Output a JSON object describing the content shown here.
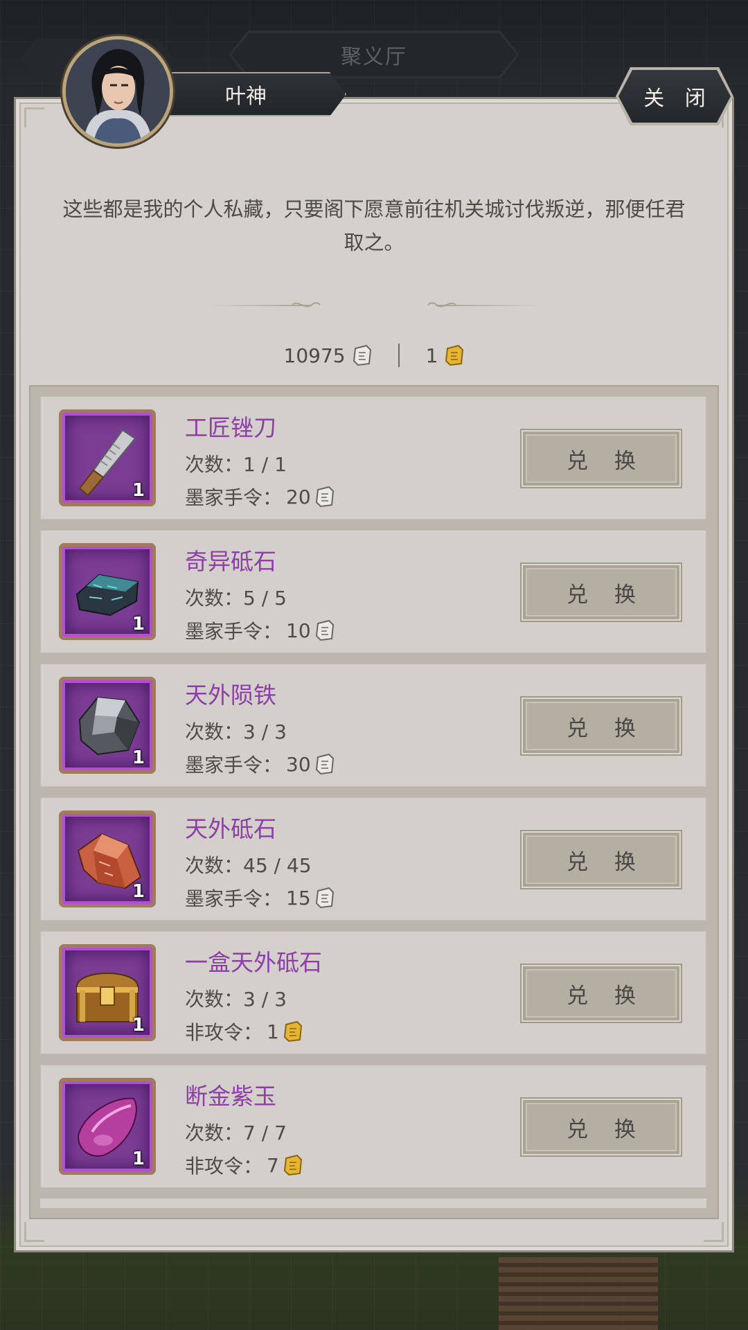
{
  "window": {
    "title": "聚义厅"
  },
  "npc": {
    "name": "叶神"
  },
  "close_label": "关 闭",
  "intro": "这些都是我的个人私藏，只要阁下愿意前往机关城讨伐叛逆，那便任君取之。",
  "currencies": [
    {
      "value": "10975",
      "icon": "mojia-token-icon",
      "color": "#e9e6df"
    },
    {
      "value": "1",
      "icon": "feigong-token-icon",
      "color": "#e2b23a"
    }
  ],
  "items": [
    {
      "name": "工匠锉刀",
      "count": "1",
      "times_label": "次数：",
      "times": "1 / 1",
      "cost_label": "墨家手令：",
      "cost": "20",
      "cost_icon": "mojia-token-icon",
      "icon": "file-knife-icon",
      "button": "兑 换"
    },
    {
      "name": "奇异砥石",
      "count": "1",
      "times_label": "次数：",
      "times": "5 / 5",
      "cost_label": "墨家手令：",
      "cost": "10",
      "cost_icon": "mojia-token-icon",
      "icon": "teal-whetstone-icon",
      "button": "兑 换"
    },
    {
      "name": "天外陨铁",
      "count": "1",
      "times_label": "次数：",
      "times": "3 / 3",
      "cost_label": "墨家手令：",
      "cost": "30",
      "cost_icon": "mojia-token-icon",
      "icon": "meteor-iron-icon",
      "button": "兑 换"
    },
    {
      "name": "天外砥石",
      "count": "1",
      "times_label": "次数：",
      "times": "45 / 45",
      "cost_label": "墨家手令：",
      "cost": "15",
      "cost_icon": "mojia-token-icon",
      "icon": "red-whetstone-icon",
      "button": "兑 换"
    },
    {
      "name": "一盒天外砥石",
      "count": "1",
      "times_label": "次数：",
      "times": "3 / 3",
      "cost_label": "非攻令：",
      "cost": "1",
      "cost_icon": "feigong-token-icon",
      "icon": "treasure-chest-icon",
      "button": "兑 换"
    },
    {
      "name": "断金紫玉",
      "count": "1",
      "times_label": "次数：",
      "times": "7 / 7",
      "cost_label": "非攻令：",
      "cost": "7",
      "cost_icon": "feigong-token-icon",
      "icon": "purple-jade-icon",
      "button": "兑 换"
    }
  ]
}
